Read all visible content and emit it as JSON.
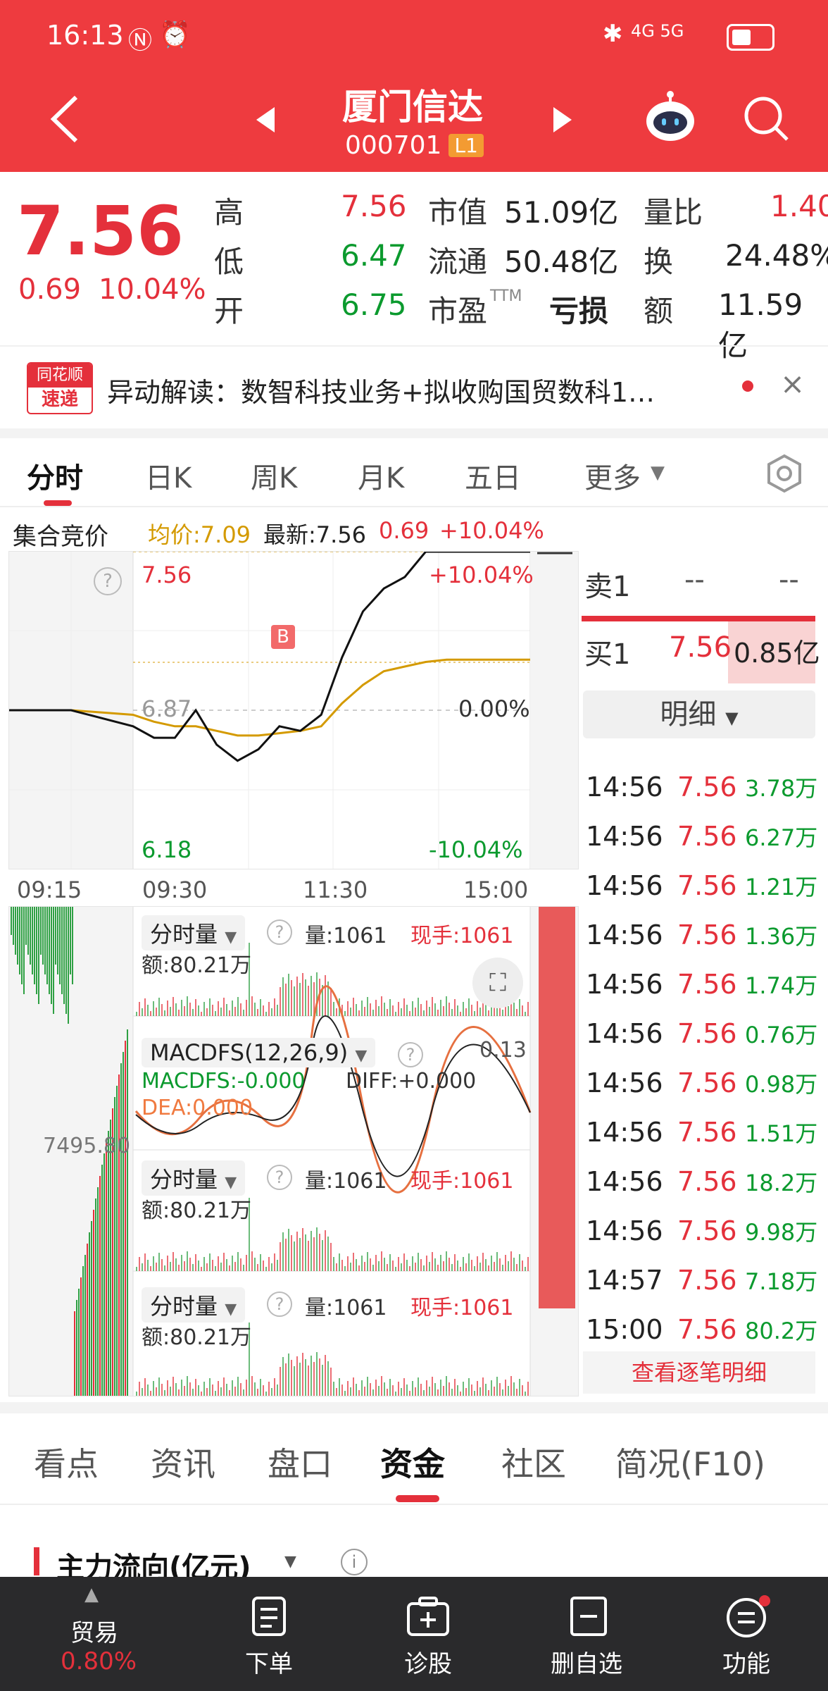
{
  "status": {
    "time": "16:13",
    "indicators": "4G 5G"
  },
  "header": {
    "title": "厦门信达",
    "code": "000701",
    "level": "L1"
  },
  "quote": {
    "price": "7.56",
    "change": "0.69",
    "change_pct": "10.04%",
    "high_label": "高",
    "high": "7.56",
    "low_label": "低",
    "low": "6.47",
    "open_label": "开",
    "open": "6.75",
    "mcap_label": "市值",
    "mcap": "51.09亿",
    "float_label": "流通",
    "float": "50.48亿",
    "pe_label": "市盈",
    "pe_sup": "TTM",
    "pe": "亏损",
    "volratio_label": "量比",
    "volratio": "1.40",
    "turnover_label": "换",
    "turnover": "24.48%",
    "amount_label": "额",
    "amount": "11.59亿"
  },
  "news": {
    "badge_top": "同花顺",
    "badge_bottom": "速递",
    "text": "异动解读：数智科技业务+拟收购国贸数科1…"
  },
  "chart_tabs": [
    "分时",
    "日K",
    "周K",
    "月K",
    "五日",
    "更多"
  ],
  "intraday": {
    "auction_label": "集合竞价",
    "avg": "均价:7.09",
    "latest": "最新:7.56",
    "change": "0.69",
    "change_pct": "+10.04%",
    "top_price": "7.56",
    "top_pct": "+10.04%",
    "mid_price": "6.87",
    "mid_pct": "0.00%",
    "bottom_price": "6.18",
    "bottom_pct": "-10.04%",
    "times": [
      "09:15",
      "09:30",
      "11:30",
      "15:00"
    ],
    "marker": "B",
    "vol_value": "7495.80"
  },
  "chart_data": {
    "type": "line",
    "series": [
      {
        "values": [
          6.87,
          6.87,
          6.8,
          6.75,
          6.75,
          6.87,
          6.72,
          6.65,
          6.7,
          6.8,
          6.78,
          6.85,
          7.1,
          7.3,
          7.4,
          7.45,
          7.56,
          7.56,
          7.56,
          7.56,
          7.56,
          7.56
        ]
      },
      {
        "values": [
          6.87,
          6.87,
          6.85,
          6.82,
          6.8,
          6.8,
          6.78,
          6.76,
          6.76,
          6.77,
          6.78,
          6.8,
          6.9,
          6.98,
          7.04,
          7.06,
          7.08,
          7.09,
          7.09,
          7.09,
          7.09,
          7.09
        ]
      }
    ],
    "ylim": [
      6.18,
      7.56
    ]
  },
  "sub_panels": [
    {
      "title": "分时量",
      "vol": "量:1061",
      "hand": "现手:1061",
      "amt": "额:80.21万"
    },
    {
      "title": "MACDFS(12,26,9)",
      "val": "0.13",
      "macd": "MACDFS:-0.000",
      "diff": "DIFF:+0.000",
      "dea": "DEA:0.000"
    },
    {
      "title": "分时量",
      "vol": "量:1061",
      "hand": "现手:1061",
      "amt": "额:80.21万"
    },
    {
      "title": "分时量",
      "vol": "量:1061",
      "hand": "现手:1061",
      "amt": "额:80.21万"
    }
  ],
  "order_book": {
    "sell_label": "卖1",
    "sell_price": "--",
    "sell_vol": "--",
    "buy_label": "买1",
    "buy_price": "7.56",
    "buy_vol": "0.85亿",
    "detail_label": "明细"
  },
  "ticks": [
    {
      "time": "14:56",
      "price": "7.56",
      "vol": "3.78万"
    },
    {
      "time": "14:56",
      "price": "7.56",
      "vol": "6.27万"
    },
    {
      "time": "14:56",
      "price": "7.56",
      "vol": "1.21万"
    },
    {
      "time": "14:56",
      "price": "7.56",
      "vol": "1.36万"
    },
    {
      "time": "14:56",
      "price": "7.56",
      "vol": "1.74万"
    },
    {
      "time": "14:56",
      "price": "7.56",
      "vol": "0.76万"
    },
    {
      "time": "14:56",
      "price": "7.56",
      "vol": "0.98万"
    },
    {
      "time": "14:56",
      "price": "7.56",
      "vol": "1.51万"
    },
    {
      "time": "14:56",
      "price": "7.56",
      "vol": "18.2万"
    },
    {
      "time": "14:56",
      "price": "7.56",
      "vol": "9.98万"
    },
    {
      "time": "14:57",
      "price": "7.56",
      "vol": "7.18万"
    },
    {
      "time": "15:00",
      "price": "7.56",
      "vol": "80.2万"
    }
  ],
  "tick_more": "查看逐笔明细",
  "info_tabs": [
    "看点",
    "资讯",
    "盘口",
    "资金",
    "社区",
    "简况(F10)"
  ],
  "flow_title": "主力流向(亿元)",
  "bottom_nav": [
    {
      "label": "贸易",
      "sub": "0.80%"
    },
    {
      "label": "下单"
    },
    {
      "label": "诊股"
    },
    {
      "label": "删自选"
    },
    {
      "label": "功能"
    }
  ],
  "colors": {
    "up": "#e4303b",
    "down": "#0b9a2e",
    "avg": "#d49a00",
    "header": "#ee3b3f"
  }
}
